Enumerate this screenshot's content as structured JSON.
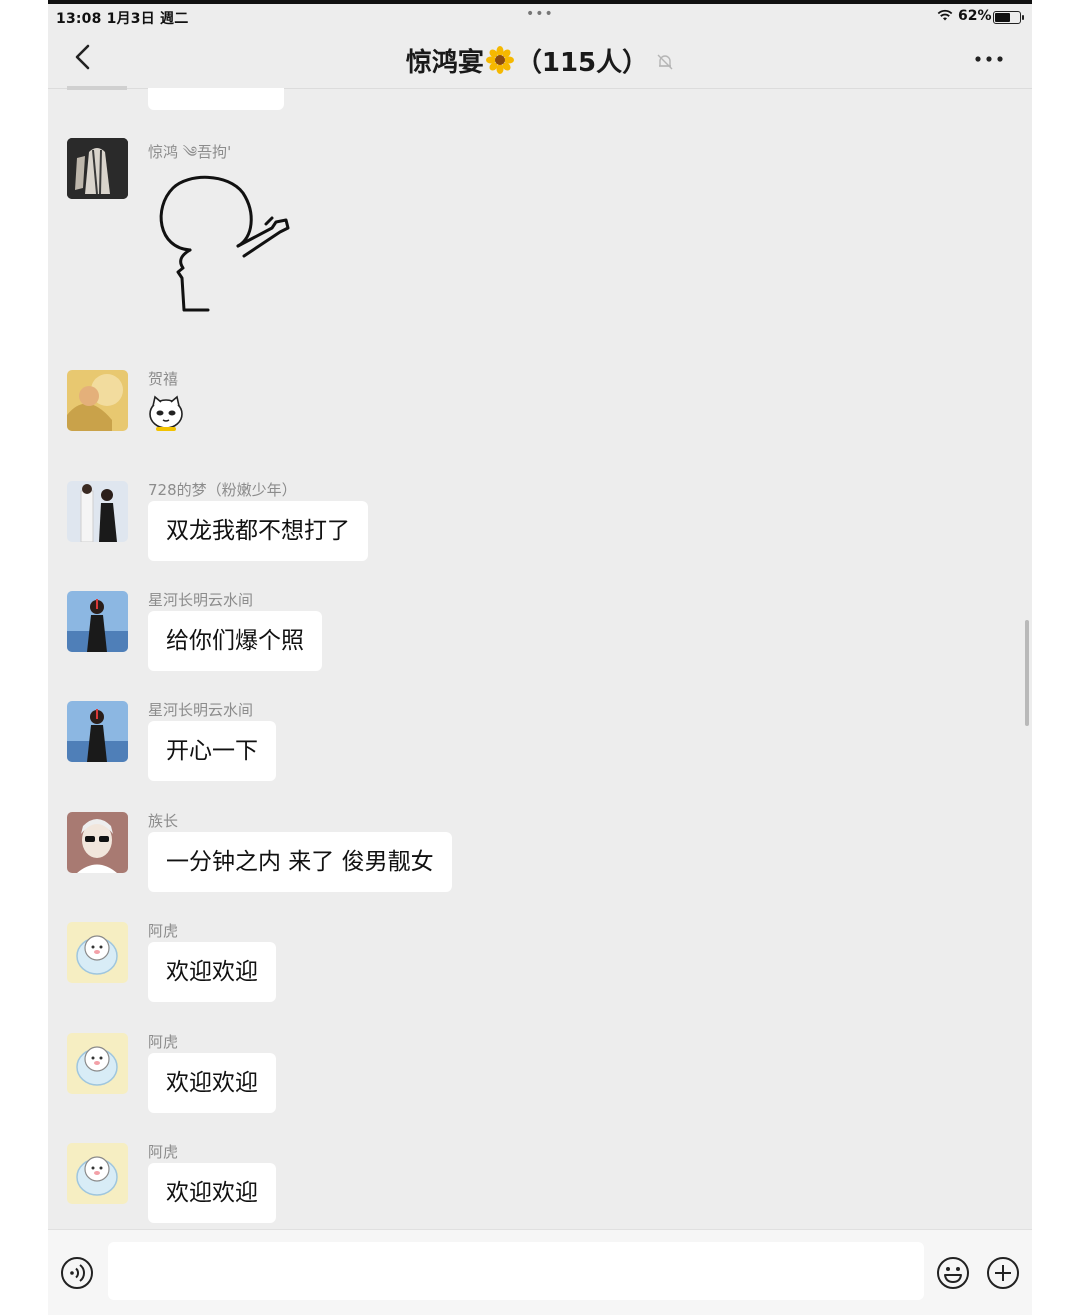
{
  "status_bar": {
    "time_date": "13:08  1月3日 週二",
    "battery": "62%",
    "battery_level": 0.62
  },
  "nav": {
    "title": "惊鸿宴",
    "member_count": "（115人）",
    "icons": [
      "back-chevron-icon",
      "flower-icon",
      "mute-bell-icon",
      "more-dots-icon"
    ]
  },
  "messages": [
    {
      "sender": "惊鸿 ༄吾拘'",
      "type": "sticker",
      "sticker": "line-drawing-pointing-figure"
    },
    {
      "sender": "贺禧",
      "type": "sticker",
      "sticker": "cat-face-emoji"
    },
    {
      "sender": "728的梦（粉嫩少年）",
      "type": "text",
      "text": "双龙我都不想打了"
    },
    {
      "sender": "星河长明云水间",
      "type": "text",
      "text": "给你们爆个照"
    },
    {
      "sender": "星河长明云水间",
      "type": "text",
      "text": "开心一下"
    },
    {
      "sender": "族长",
      "type": "text",
      "text": "一分钟之内 来了 俊男靓女"
    },
    {
      "sender": "阿虎",
      "type": "text",
      "text": "欢迎欢迎"
    },
    {
      "sender": "阿虎",
      "type": "text",
      "text": "欢迎欢迎"
    },
    {
      "sender": "阿虎",
      "type": "text",
      "text": "欢迎欢迎"
    }
  ],
  "input_bar": {
    "value": "",
    "icons": [
      "voice-icon",
      "emoji-icon",
      "plus-icon"
    ]
  },
  "colors": {
    "background": "#ededed",
    "bubble": "#ffffff",
    "sender_text": "#8c8c8c"
  }
}
